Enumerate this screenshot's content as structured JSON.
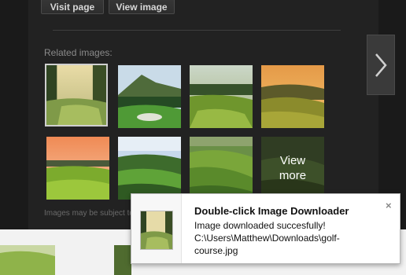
{
  "toolbar": {
    "visit_label": "Visit page",
    "view_label": "View image"
  },
  "related": {
    "label": "Related images:",
    "thumbnails": [
      {
        "name": "golf-course-sunrise-fairway"
      },
      {
        "name": "golf-course-mountain-view"
      },
      {
        "name": "golf-course-evening-green"
      },
      {
        "name": "golf-course-sunset-hills"
      },
      {
        "name": "golf-course-pink-sky"
      },
      {
        "name": "golf-course-blue-sky-hills"
      },
      {
        "name": "golf-course-rolling-fairway"
      },
      {
        "name": "view-more-tile"
      }
    ],
    "view_more_label": "View\nmore",
    "notice": "Images may be subject to copyright."
  },
  "notification": {
    "title": "Double-click Image Downloader",
    "message": "Image downloaded succesfully!",
    "path": "C:\\Users\\Matthew\\Downloads\\golf-course.jpg",
    "close_icon": "close-icon"
  },
  "icons": {
    "next": "chevron-right-icon"
  },
  "colors": {
    "panel_bg": "#222222",
    "notification_bg": "#ffffff",
    "text_muted": "#8a8a8a"
  }
}
